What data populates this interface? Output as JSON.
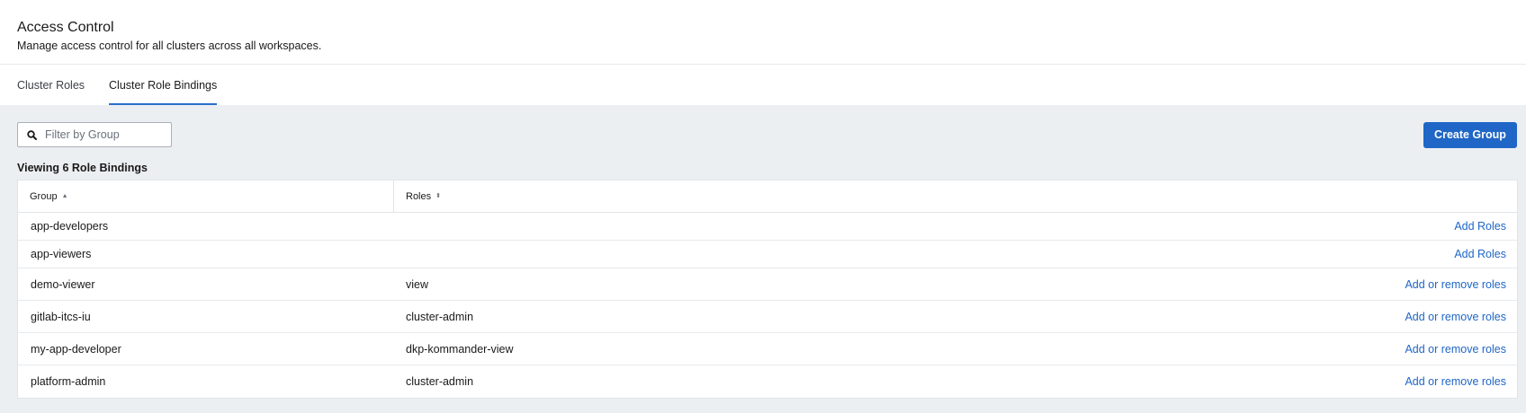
{
  "header": {
    "title": "Access Control",
    "subtitle": "Manage access control for all clusters across all workspaces."
  },
  "tabs": [
    {
      "label": "Cluster Roles",
      "active": false
    },
    {
      "label": "Cluster Role Bindings",
      "active": true
    }
  ],
  "toolbar": {
    "search_placeholder": "Filter by Group",
    "search_icon": "search-icon",
    "create_label": "Create Group"
  },
  "count_label": "Viewing 6 Role Bindings",
  "table": {
    "columns": [
      {
        "label": "Group",
        "sort_icon": "sort-ascending-icon"
      },
      {
        "label": "Roles",
        "sort_icon": "sort-neutral-icon"
      }
    ],
    "rows": [
      {
        "group": "app-developers",
        "roles": "",
        "action": "Add Roles"
      },
      {
        "group": "app-viewers",
        "roles": "",
        "action": "Add Roles"
      },
      {
        "group": "demo-viewer",
        "roles": "view",
        "action": "Add or remove roles"
      },
      {
        "group": "gitlab-itcs-iu",
        "roles": "cluster-admin",
        "action": "Add or remove roles"
      },
      {
        "group": "my-app-developer",
        "roles": "dkp-kommander-view",
        "action": "Add or remove roles"
      },
      {
        "group": "platform-admin",
        "roles": "cluster-admin",
        "action": "Add or remove roles"
      }
    ]
  },
  "colors": {
    "accent": "#1f66c6",
    "tab_underline": "#2a6fc9",
    "content_bg": "#eceff2"
  }
}
